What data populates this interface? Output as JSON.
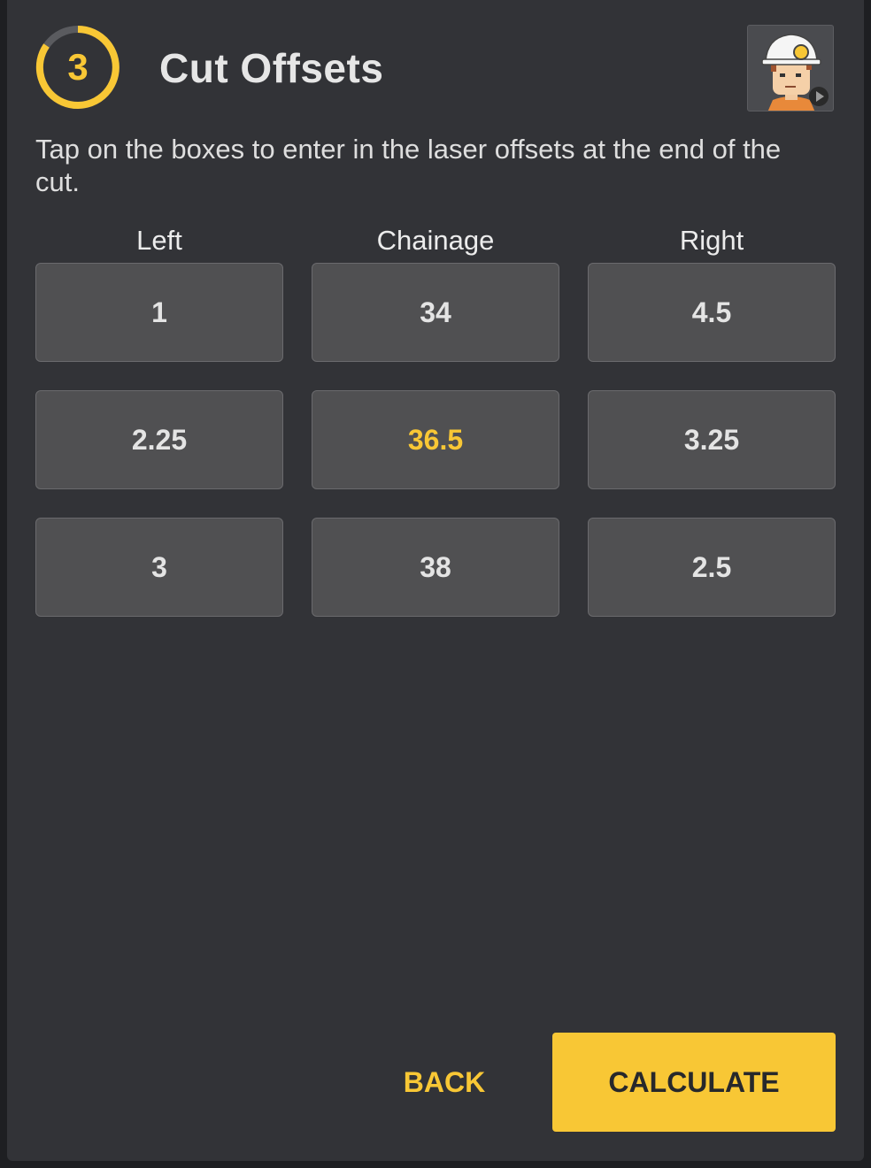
{
  "step": {
    "number": "3",
    "progress": 0.9
  },
  "header": {
    "title": "Cut Offsets",
    "avatar_icon": "miner-avatar-play-icon"
  },
  "instructions": "Tap on the boxes to enter in the laser offsets at the end of the cut.",
  "columns": [
    "Left",
    "Chainage",
    "Right"
  ],
  "rows": [
    {
      "left": "1",
      "chainage": "34",
      "right": "4.5"
    },
    {
      "left": "2.25",
      "chainage": "36.5",
      "right": "3.25"
    },
    {
      "left": "3",
      "chainage": "38",
      "right": "2.5"
    }
  ],
  "selected_cell": "row2-chainage",
  "buttons": {
    "back": "BACK",
    "calculate": "CALCULATE"
  },
  "colors": {
    "accent": "#f8c735",
    "panel": "#323337",
    "cell": "#505052"
  }
}
